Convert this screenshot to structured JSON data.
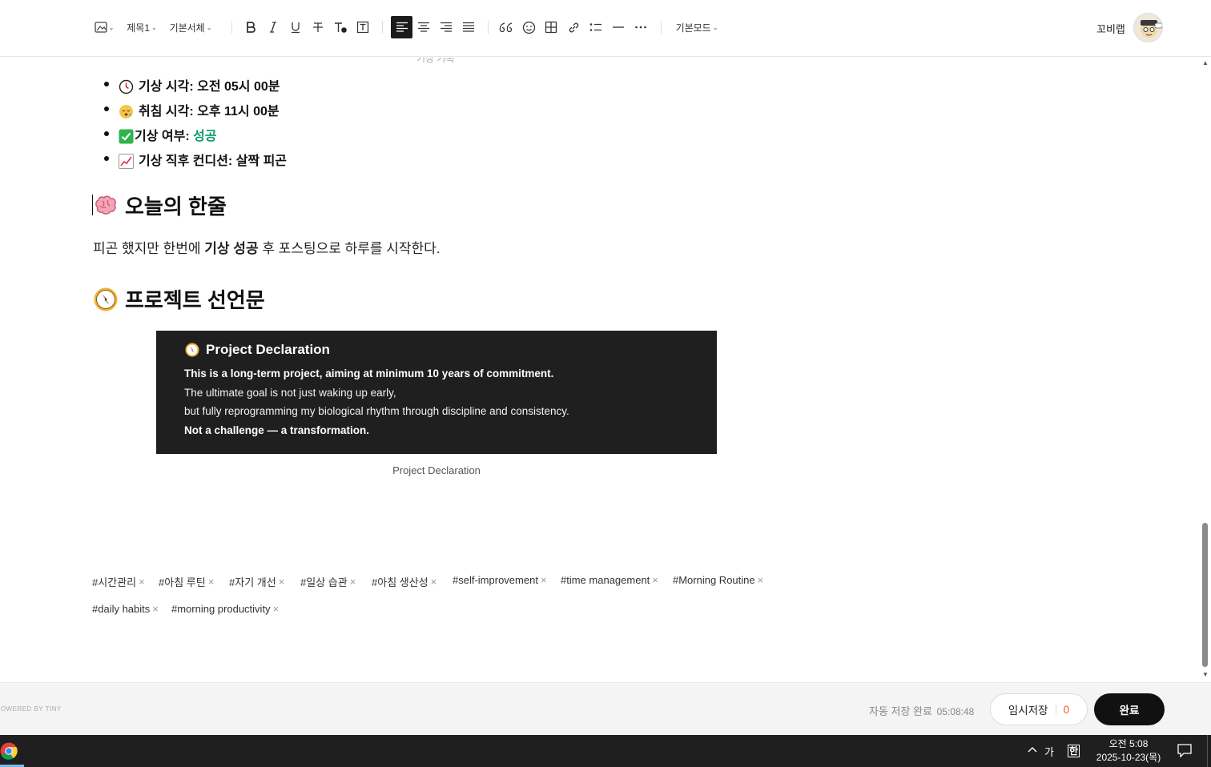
{
  "toolbar": {
    "heading_select": "제목1",
    "font_select": "기본서체",
    "mode_select": "기본모드",
    "user_name": "꼬비랩"
  },
  "content": {
    "cut_text": "기상 기록",
    "bullets": [
      {
        "label": "기상 시각: 오전 05시 00분",
        "icon": "clock-icon"
      },
      {
        "label": "취침 시각: 오후 11시 00분",
        "icon": "sleeping-face-icon"
      },
      {
        "label": "기상 여부: ",
        "value": "성공",
        "icon": "check-mark-icon"
      },
      {
        "label": "기상 직후 컨디션: 살짝 피곤",
        "icon": "chart-icon"
      }
    ],
    "section1_title": "오늘의 한줄",
    "paragraph": {
      "before": "피곤 했지만 한번에 ",
      "bold": "기상 성공",
      "after": " 후 포스팅으로 하루를 시작한다."
    },
    "section2_title": "프로젝트 선언문",
    "image": {
      "title": "Project Declaration",
      "line1": "This is a long-term project, aiming at minimum 10 years of commitment.",
      "line2": "The ultimate goal is not just waking up early,",
      "line3": "but fully reprogramming my biological rhythm through discipline and consistency.",
      "line4": "Not a challenge — a transformation."
    },
    "caption": "Project Declaration"
  },
  "tags": [
    "#시간관리",
    "#아침 루틴",
    "#자기 개선",
    "#일상 습관",
    "#아침 생산성",
    "#self-improvement",
    "#time management",
    "#Morning Routine",
    "#daily habits",
    "#morning productivity"
  ],
  "footer": {
    "powered": "POWERED BY TINY",
    "autosave_label": "자동 저장 완료",
    "autosave_time": "05:08:48",
    "draft_label": "임시저장",
    "draft_count": "0",
    "done_label": "완료"
  },
  "taskbar": {
    "ime_lang": "가",
    "ime_mode": "한",
    "time": "오전 5:08",
    "date": "2025-10-23(목)"
  }
}
